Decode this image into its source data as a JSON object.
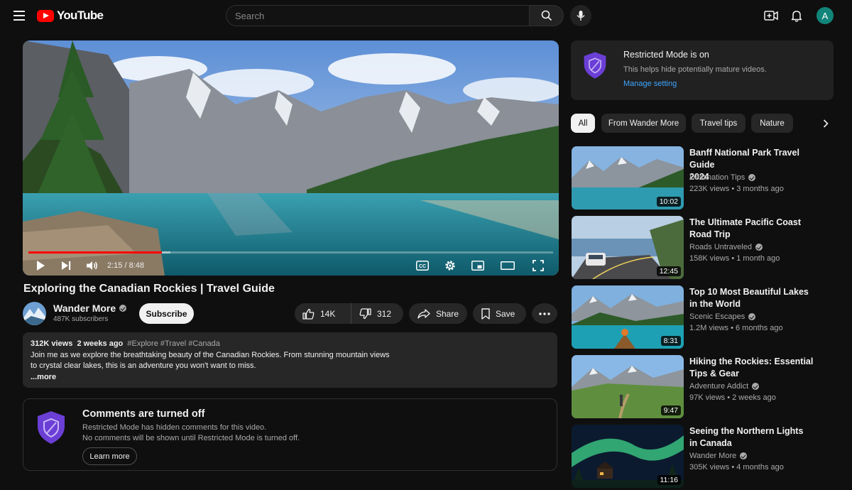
{
  "header": {
    "logo_text": "YouTube",
    "search_placeholder": "Search",
    "avatar_letter": "A"
  },
  "player": {
    "time_display": "2:15 / 8:48",
    "progress_fraction": 0.255,
    "buffered_fraction": 0.27
  },
  "video": {
    "title": "Exploring the Canadian Rockies | Travel Guide",
    "channel_name": "Wander More",
    "subscribers": "487K subscribers",
    "subscribe_label": "Subscribe",
    "likes": "14K",
    "dislikes": "312",
    "share_label": "Share",
    "save_label": "Save"
  },
  "description": {
    "views": "312K views",
    "date": "2 weeks ago",
    "tags": "#Explore #Travel #Canada",
    "line1": "Join me as we explore the breathtaking beauty of the Canadian Rockies. From stunning mountain views",
    "line2": "to crystal clear lakes, this is an adventure you won't want to miss.",
    "more_label": "...more"
  },
  "comments": {
    "title": "Comments are turned off",
    "line1": "Restricted Mode has hidden comments for this video.",
    "line2": "No comments will be shown until Restricted Mode is turned off.",
    "learn_more": "Learn more"
  },
  "restricted_notice": {
    "title": "Restricted Mode is on",
    "subtitle": "This helps hide potentially mature videos.",
    "link": "Manage setting"
  },
  "chips": [
    "All",
    "From Wander More",
    "Travel tips",
    "Nature"
  ],
  "recommendations": [
    {
      "title_line1": "Banff National Park Travel Guide",
      "title_line2": "2024",
      "channel": "Destination Tips",
      "views": "223K views",
      "age": "3 months ago",
      "duration": "10:02"
    },
    {
      "title_line1": "The Ultimate Pacific Coast",
      "title_line2": "Road Trip",
      "channel": "Roads Untraveled",
      "views": "158K views",
      "age": "1 month ago",
      "duration": "12:45"
    },
    {
      "title_line1": "Top 10 Most Beautiful Lakes",
      "title_line2": "in the World",
      "channel": "Scenic Escapes",
      "views": "1.2M views",
      "age": "6 months ago",
      "duration": "8:31"
    },
    {
      "title_line1": "Hiking the Rockies: Essential",
      "title_line2": "Tips & Gear",
      "channel": "Adventure Addict",
      "views": "97K views",
      "age": "2 weeks ago",
      "duration": "9:47"
    },
    {
      "title_line1": "Seeing the Northern Lights",
      "title_line2": "in Canada",
      "channel": "Wander More",
      "views": "305K views",
      "age": "4 months ago",
      "duration": "11:16"
    }
  ],
  "colors": {
    "accent_red": "#ff0000",
    "link_blue": "#3ea6ff",
    "shield_purple": "#6b3fd6",
    "avatar_teal": "#12857a"
  }
}
